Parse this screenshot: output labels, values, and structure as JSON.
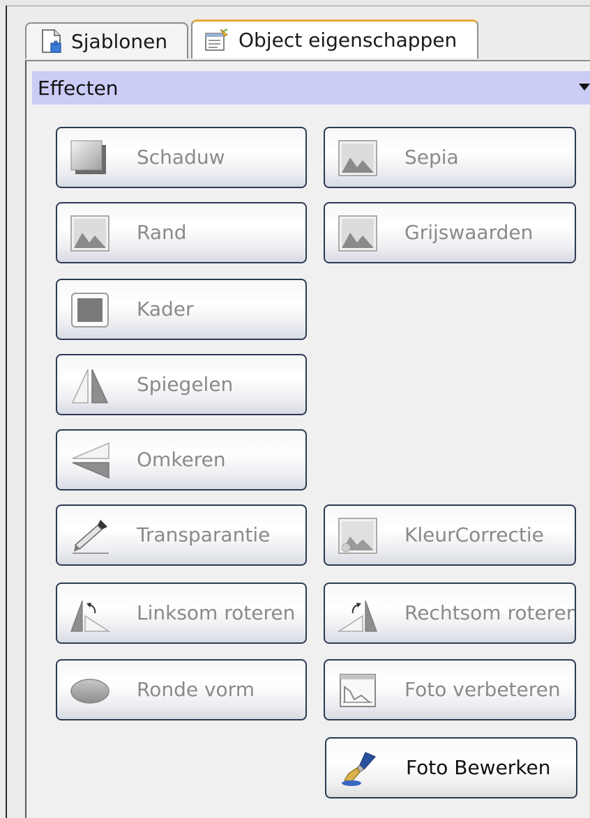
{
  "tabs": [
    {
      "label": "Sjablonen",
      "icon": "template-page-icon"
    },
    {
      "label": "Object eigenschappen",
      "icon": "object-properties-icon",
      "active": true
    }
  ],
  "section": {
    "title": "Effecten"
  },
  "buttons": {
    "schaduw": "Schaduw",
    "sepia": "Sepia",
    "rand": "Rand",
    "grijswaarden": "Grijswaarden",
    "kader": "Kader",
    "spiegelen": "Spiegelen",
    "omkeren": "Omkeren",
    "transparantie": "Transparantie",
    "kleurcorrectie": "KleurCorrectie",
    "linksom": "Linksom roteren",
    "rechtsom": "Rechtsom roteren",
    "ronde_vorm": "Ronde vorm",
    "foto_verbeteren": "Foto verbeteren",
    "foto_bewerken": "Foto Bewerken"
  },
  "colors": {
    "section_header": "#cbcdf7",
    "active_tab_accent": "#e5a93a",
    "disabled_text": "#8a8a8a",
    "button_border": "#2c3a52"
  }
}
